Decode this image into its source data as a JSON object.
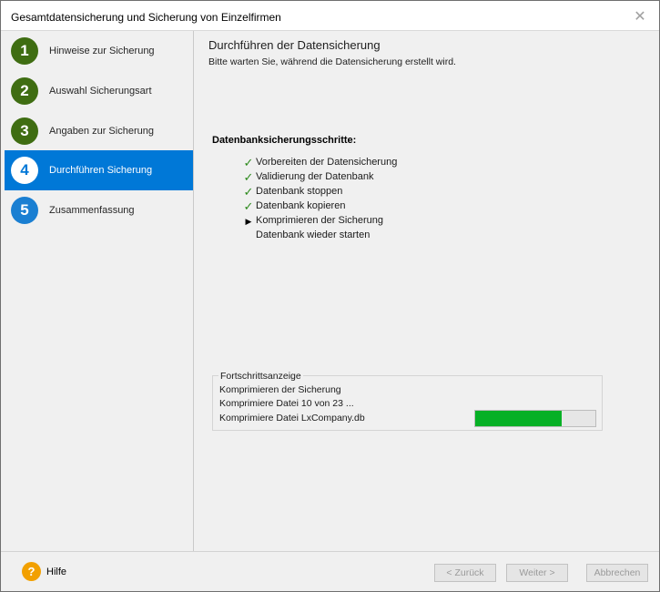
{
  "window": {
    "title": "Gesamtdatensicherung und Sicherung von Einzelfirmen",
    "close_glyph": "✕",
    "close_icon": "close-icon"
  },
  "sidebar": {
    "items": [
      {
        "number": "1",
        "label": "Hinweise zur Sicherung",
        "state": "done"
      },
      {
        "number": "2",
        "label": "Auswahl Sicherungsart",
        "state": "done"
      },
      {
        "number": "3",
        "label": "Angaben zur Sicherung",
        "state": "done"
      },
      {
        "number": "4",
        "label": "Durchführen Sicherung",
        "state": "current"
      },
      {
        "number": "5",
        "label": "Zusammenfassung",
        "state": "pending"
      }
    ]
  },
  "main": {
    "heading": "Durchführen der Datensicherung",
    "subheading": "Bitte warten Sie, während die Datensicherung erstellt wird.",
    "steps_title": "Datenbanksicherungsschritte:",
    "steps": [
      {
        "label": "Vorbereiten der Datensicherung",
        "status": "done",
        "icon": "checkmark-icon"
      },
      {
        "label": "Validierung der Datenbank",
        "status": "done",
        "icon": "checkmark-icon"
      },
      {
        "label": "Datenbank stoppen",
        "status": "done",
        "icon": "checkmark-icon"
      },
      {
        "label": "Datenbank kopieren",
        "status": "done",
        "icon": "checkmark-icon"
      },
      {
        "label": "Komprimieren der Sicherung",
        "status": "in-progress",
        "icon": "arrow-right-icon"
      },
      {
        "label": "Datenbank wieder starten",
        "status": "pending",
        "icon": ""
      }
    ],
    "glyphs": {
      "check": "✓",
      "arrow": "▶"
    }
  },
  "progress": {
    "legend": "Fortschrittsanzeige",
    "line1": "Komprimieren der Sicherung",
    "line2": "Komprimiere Datei 10 von 23 ...",
    "line3": "Komprimiere Datei LxCompany.db",
    "fraction": 0.72
  },
  "footer": {
    "help_glyph": "?",
    "help_icon": "help-icon",
    "help_label": "Hilfe",
    "back_label": "< Zurück",
    "next_label": "Weiter >",
    "cancel_label": "Abbrechen"
  },
  "colors": {
    "accent": "#0078d7",
    "step_done": "#3f6d12",
    "step_pending": "#1a7fd2",
    "progress_fill": "#06b025",
    "checkmark": "#2c8a1c",
    "help_icon": "#f2a000"
  }
}
